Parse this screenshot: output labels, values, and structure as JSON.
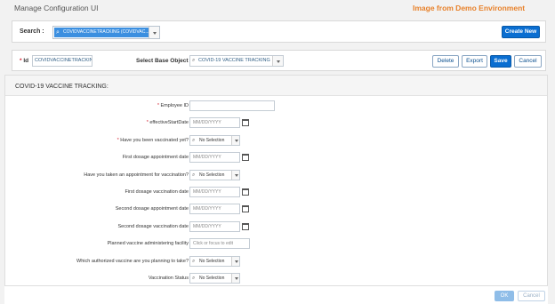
{
  "app": {
    "title": "Manage Configuration UI",
    "demo_banner": "Image from Demo Environment"
  },
  "search": {
    "label": "Search :",
    "value": "COVIDVACCINETRACKING (COVIDVAC...",
    "create_label": "Create New"
  },
  "record": {
    "id_label": "Id",
    "id_value": "COVIDVACCINETRACKING",
    "base_label": "Select Base Object",
    "base_value": "COVID-19 VACCINE TRACKING",
    "delete_label": "Delete",
    "export_label": "Export",
    "save_label": "Save",
    "cancel_label": "Cancel"
  },
  "form": {
    "header": "COVID-19 VACCINE TRACKING:",
    "fields": [
      {
        "label": "Employee ID",
        "required": "*",
        "type": "text",
        "value": ""
      },
      {
        "label": "effectiveStartDate",
        "required": "*",
        "type": "date",
        "value": "MM/DD/YYYY"
      },
      {
        "label": "Have you been vaccinated yet?",
        "required": "*",
        "type": "select",
        "value": "No Selection"
      },
      {
        "label": "First dosage appointment date",
        "required": "",
        "type": "date",
        "value": "MM/DD/YYYY"
      },
      {
        "label": "Have you taken an appointment for vaccination?",
        "required": "",
        "type": "select",
        "value": "No Selection"
      },
      {
        "label": "First dosage vaccination date",
        "required": "",
        "type": "date",
        "value": "MM/DD/YYYY"
      },
      {
        "label": "Second dosage appointment date",
        "required": "",
        "type": "date",
        "value": "MM/DD/YYYY"
      },
      {
        "label": "Second dosage vaccination date",
        "required": "",
        "type": "date",
        "value": "MM/DD/YYYY"
      },
      {
        "label": "Planned vaccine administering facility",
        "required": "",
        "type": "plain",
        "value": "Click or focus to edit"
      },
      {
        "label": "Which authorized vaccine are you planning to take?",
        "required": "",
        "type": "select",
        "value": "No Selection"
      },
      {
        "label": "Vaccination Status",
        "required": "",
        "type": "select",
        "value": "No Selection"
      }
    ]
  },
  "footer": {
    "ok_label": "OK",
    "cancel_label": "Cancel"
  }
}
